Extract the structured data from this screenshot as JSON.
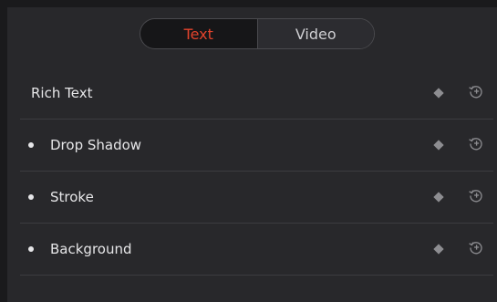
{
  "tabs": {
    "text_label": "Text",
    "video_label": "Video",
    "selected": "Text"
  },
  "rows": [
    {
      "label": "Rich Text",
      "has_bullet": false,
      "keyframe_icon": "diamond-icon",
      "reset_icon": "reset-icon"
    },
    {
      "label": "Drop Shadow",
      "has_bullet": true,
      "keyframe_icon": "diamond-icon",
      "reset_icon": "reset-icon"
    },
    {
      "label": "Stroke",
      "has_bullet": true,
      "keyframe_icon": "diamond-icon",
      "reset_icon": "reset-icon"
    },
    {
      "label": "Background",
      "has_bullet": true,
      "keyframe_icon": "diamond-icon",
      "reset_icon": "reset-icon"
    }
  ],
  "colors": {
    "accent": "#e2432c",
    "panel": "#28282b",
    "text": "#e6e6e8",
    "icon": "#8d8d91"
  }
}
